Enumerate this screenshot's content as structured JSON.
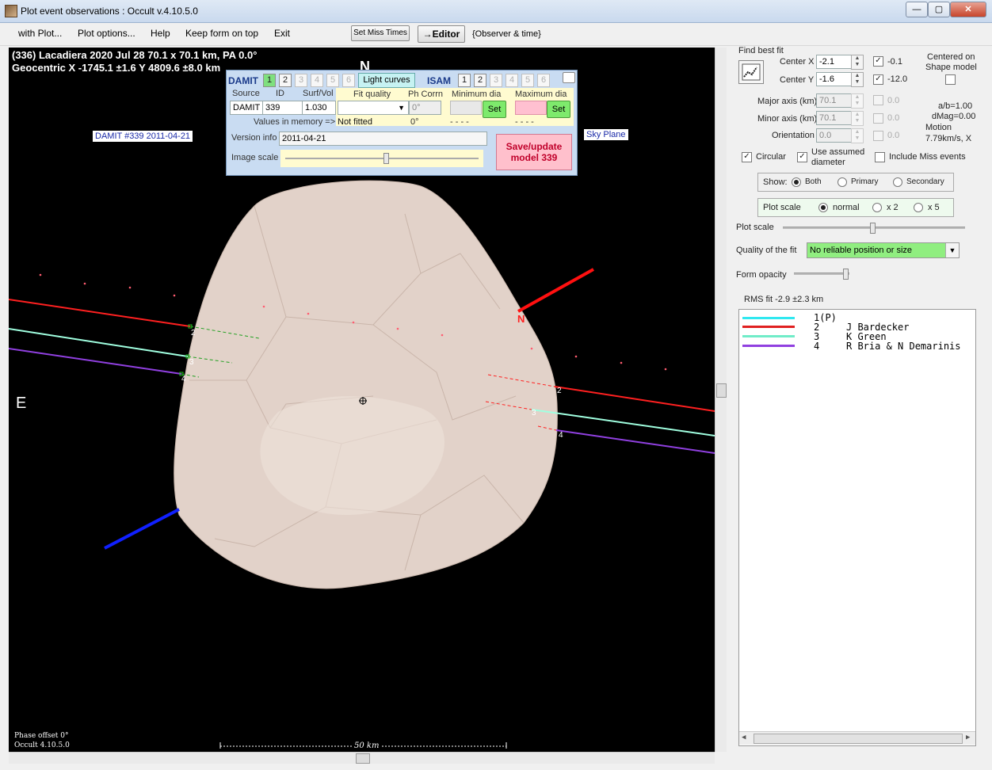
{
  "window": {
    "title": "Plot event observations : Occult v.4.10.5.0"
  },
  "menu": {
    "items": [
      "with Plot...",
      "Plot options...",
      "Help",
      "Keep form on top",
      "Exit"
    ],
    "set_miss_times": "Set Miss Times",
    "editor": "→Editor",
    "observer_time": "{Observer & time}"
  },
  "plot": {
    "header_line1": "(336) Lacadiera  2020 Jul 28  70.1 x 70.1 km, PA 0.0°",
    "header_line2": "Geocentric  X  -1745.1 ±1.6  Y 4809.6 ±8.0 km",
    "north_label": "N",
    "east_label": "E",
    "damit_tag": "DAMIT #339 2011-04-21",
    "sky_plane": "Sky Plane",
    "axis_north_label": "N",
    "chord_labels": [
      "2",
      "3",
      "4",
      "2",
      "3",
      "4"
    ],
    "phase_offset": "Phase offset 0°",
    "version": "Occult 4.10.5.0",
    "scale_label": "50 km",
    "colors": {
      "chord_2": "#ff2020",
      "chord_3": "#a0ffe0",
      "chord_4": "#9040e0",
      "pole_red": "#ff1010",
      "pole_blue": "#1020ff"
    }
  },
  "damit_panel": {
    "damit_label": "DAMIT",
    "damit_models": [
      "1",
      "2",
      "3",
      "4",
      "5",
      "6"
    ],
    "light_curves": "Light curves",
    "isam_label": "ISAM",
    "isam_models": [
      "1",
      "2",
      "3",
      "4",
      "5",
      "6"
    ],
    "source_label": "Source",
    "id_label": "ID",
    "surfvol_label": "Surf/Vol",
    "source_value": "DAMIT",
    "id_value": "339",
    "surfvol_value": "1.030",
    "values_in_memory": "Values in memory =>",
    "fit_quality_label": "Fit quality",
    "ph_corrn_label": "Ph Corrn",
    "min_dia_label": "Minimum dia",
    "max_dia_label": "Maximum dia",
    "ph_corrn_value": "0°",
    "set_label": "Set",
    "fit_memory": "Not fitted",
    "ph_memory": "0°",
    "min_memory": "- - - -",
    "max_memory": "- - - -",
    "version_info_label": "Version info",
    "version_info_value": "2011-04-21",
    "image_scale_label": "Image scale",
    "save_button": "Save/update model 339"
  },
  "right_panel": {
    "find_best_fit": "Find best fit",
    "center_x_label": "Center X",
    "center_x_value": "-2.1",
    "center_x_check": "-0.1",
    "center_y_label": "Center Y",
    "center_y_value": "-1.6",
    "center_y_check": "-12.0",
    "centered_on": "Centered on",
    "shape_model": "Shape model",
    "major_label": "Major axis (km)",
    "major_value": "70.1",
    "major_check": "0.0",
    "minor_label": "Minor axis (km)",
    "minor_value": "70.1",
    "minor_check": "0.0",
    "orient_label": "Orientation",
    "orient_value": "0.0",
    "orient_check": "0.0",
    "ab_ratio": "a/b=1.00",
    "dmag": "dMag=0.00",
    "motion_label": "Motion",
    "motion_value": "7.79km/s, X",
    "circular": "Circular",
    "use_assumed_1": "Use assumed",
    "use_assumed_2": "diameter",
    "include_miss": "Include Miss events",
    "show_label": "Show:",
    "show_options": [
      "Both",
      "Primary",
      "Secondary"
    ],
    "plot_scale_group": "Plot scale",
    "plot_scale_options": [
      "normal",
      "x 2",
      "x 5"
    ],
    "plot_scale_label": "Plot scale",
    "quality_label": "Quality of the fit",
    "quality_value": "No reliable position or size",
    "form_opacity": "Form opacity",
    "rms_fit": "RMS fit -2.9 ±2.3 km",
    "legend": [
      {
        "num": "1(P)",
        "name": "",
        "color": "#30e8f0"
      },
      {
        "num": "2",
        "name": "J Bardecker",
        "color": "#e02020"
      },
      {
        "num": "3",
        "name": "K Green",
        "color": "#70ecc8"
      },
      {
        "num": "4",
        "name": "R Bria & N Demarinis",
        "color": "#9040e0"
      }
    ]
  }
}
